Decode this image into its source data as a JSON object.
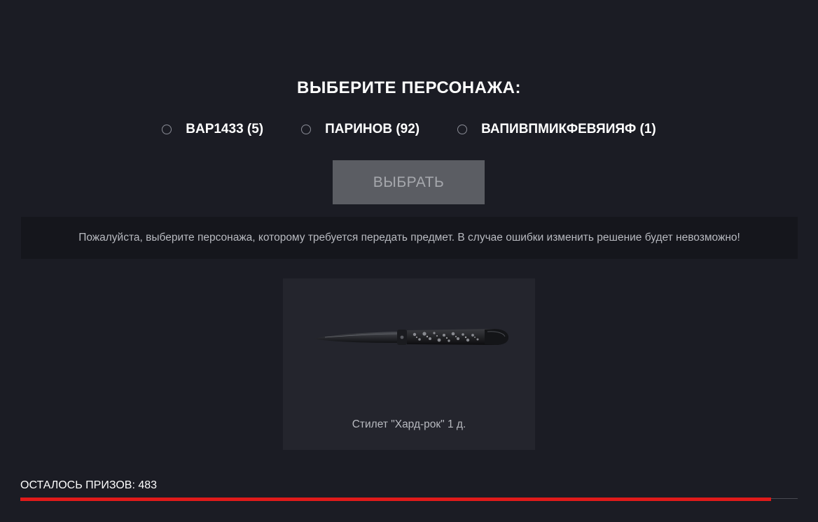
{
  "header": {
    "title": "ВЫБЕРИТЕ ПЕРСОНАЖА:"
  },
  "characters": [
    {
      "label": "BAP1433 (5)",
      "selected": false
    },
    {
      "label": "ПАРИНОВ (92)",
      "selected": false
    },
    {
      "label": "ВАПИВПМИКФЕВЯИЯФ (1)",
      "selected": false
    }
  ],
  "select_button": {
    "label": "ВЫБРАТЬ"
  },
  "notice": {
    "text": "Пожалуйста, выберите персонажа, которому требуется передать предмет. В случае ошибки изменить решение будет невозможно!"
  },
  "prize": {
    "name": "Стилет \"Хард-рок\" 1 д.",
    "icon": "stiletto-knife-icon"
  },
  "remaining": {
    "text": "ОСТАЛОСЬ ПРИЗОВ: 483",
    "progress_fraction": 0.966
  },
  "colors": {
    "background": "#1b1c24",
    "accent": "#e01a1a",
    "button": "#5b5d63"
  }
}
